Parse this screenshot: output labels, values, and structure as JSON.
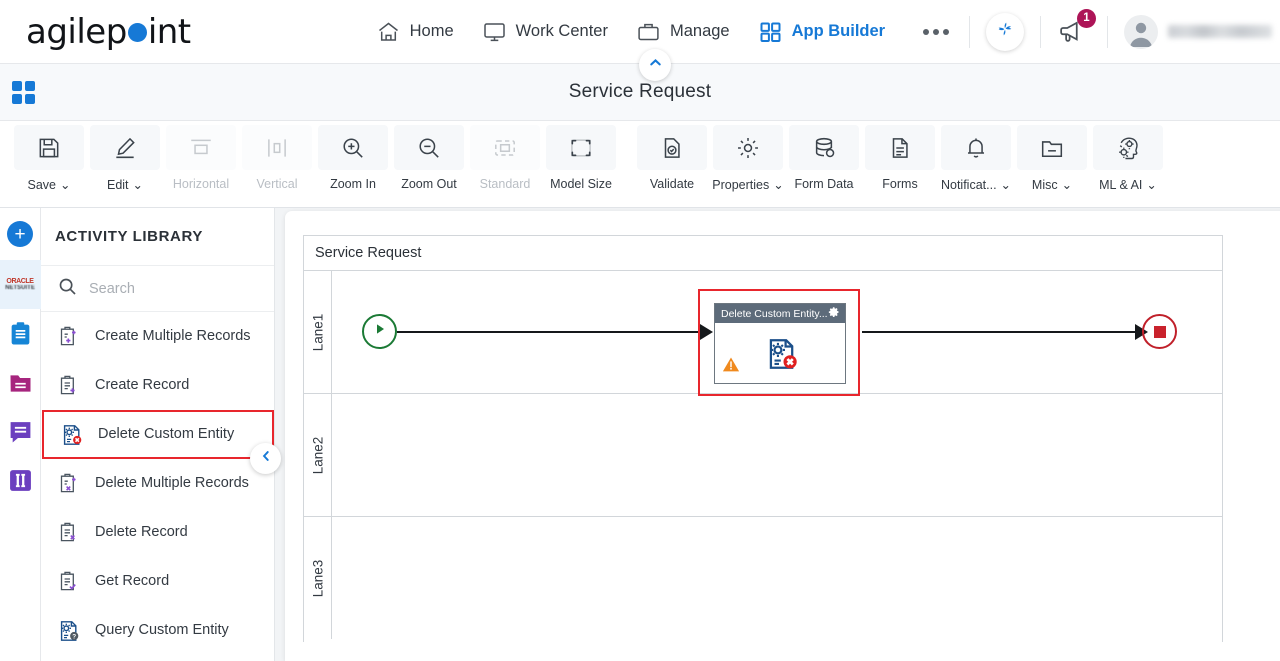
{
  "brand": {
    "name_a": "agilep",
    "name_b": "int",
    "accent": "#1679d6"
  },
  "topnav": {
    "items": [
      {
        "label": "Home",
        "icon": "home-icon",
        "active": false
      },
      {
        "label": "Work Center",
        "icon": "monitor-icon",
        "active": false
      },
      {
        "label": "Manage",
        "icon": "briefcase-icon",
        "active": false
      },
      {
        "label": "App Builder",
        "icon": "grid-icon",
        "active": true
      }
    ],
    "overflow_label": "...",
    "apps_icon": "pinwheel-icon",
    "announcements_icon": "megaphone-icon",
    "announcements_count": "1",
    "badge_color": "#ad1457",
    "avatar_icon": "user-avatar-icon",
    "username": ""
  },
  "module": {
    "grid_icon": "app-grid-icon",
    "title": "Service Request",
    "collapse_icon": "chevron-up-icon"
  },
  "toolbar": {
    "items": [
      {
        "label": "Save",
        "icon": "save-icon",
        "caret": true,
        "disabled": false
      },
      {
        "label": "Edit",
        "icon": "pencil-icon",
        "caret": true,
        "disabled": false
      },
      {
        "label": "Horizontal",
        "icon": "horizontal-icon",
        "caret": false,
        "disabled": true
      },
      {
        "label": "Vertical",
        "icon": "vertical-icon",
        "caret": false,
        "disabled": true
      },
      {
        "label": "Zoom In",
        "icon": "zoom-in-icon",
        "caret": false,
        "disabled": false
      },
      {
        "label": "Zoom Out",
        "icon": "zoom-out-icon",
        "caret": false,
        "disabled": false
      },
      {
        "label": "Standard",
        "icon": "standard-icon",
        "caret": false,
        "disabled": true
      },
      {
        "label": "Model Size",
        "icon": "model-size-icon",
        "caret": false,
        "disabled": false
      },
      {
        "label": "Validate",
        "icon": "validate-icon",
        "caret": false,
        "disabled": false
      },
      {
        "label": "Properties",
        "icon": "gear-icon",
        "caret": true,
        "disabled": false
      },
      {
        "label": "Form Data",
        "icon": "database-icon",
        "caret": false,
        "disabled": false
      },
      {
        "label": "Forms",
        "icon": "document-icon",
        "caret": false,
        "disabled": false
      },
      {
        "label": "Notificat...",
        "icon": "bell-icon",
        "caret": true,
        "disabled": false
      },
      {
        "label": "Misc",
        "icon": "folder-icon",
        "caret": true,
        "disabled": false
      },
      {
        "label": "ML & AI",
        "icon": "ml-ai-head-icon",
        "caret": true,
        "disabled": false
      }
    ]
  },
  "rail": {
    "items": [
      {
        "name": "add-button",
        "icon": "plus-icon",
        "selected": false
      },
      {
        "name": "oracle-netsuite",
        "icon": "oracle-netsuite-logo",
        "selected": true
      },
      {
        "name": "clipboard-group",
        "icon": "clipboard-icon",
        "selected": false
      },
      {
        "name": "folder-group",
        "icon": "folder-icon",
        "selected": false
      },
      {
        "name": "message-group",
        "icon": "speech-bubble-icon",
        "selected": false
      },
      {
        "name": "columns-group",
        "icon": "columns-icon",
        "selected": false
      }
    ],
    "oracle_line1": "ORACLE",
    "oracle_line2": "NETSUITE"
  },
  "library": {
    "header": "ACTIVITY LIBRARY",
    "search_placeholder": "Search",
    "search_value": "",
    "search_icon": "search-icon",
    "collapse_icon": "chevron-left-icon",
    "highlight_color": "#e8262d",
    "items": [
      {
        "label": "Create Multiple Records",
        "icon": "create-multiple-records-icon",
        "highlighted": false
      },
      {
        "label": "Create Record",
        "icon": "create-record-icon",
        "highlighted": false
      },
      {
        "label": "Delete Custom Entity",
        "icon": "delete-custom-entity-icon",
        "highlighted": true
      },
      {
        "label": "Delete Multiple Records",
        "icon": "delete-multiple-records-icon",
        "highlighted": false
      },
      {
        "label": "Delete Record",
        "icon": "delete-record-icon",
        "highlighted": false
      },
      {
        "label": "Get Record",
        "icon": "get-record-icon",
        "highlighted": false
      },
      {
        "label": "Query Custom Entity",
        "icon": "query-custom-entity-icon",
        "highlighted": false
      }
    ]
  },
  "canvas": {
    "pool_title": "Service Request",
    "lanes": [
      {
        "label": "Lane1"
      },
      {
        "label": "Lane2"
      },
      {
        "label": "Lane3"
      }
    ],
    "start_event": {
      "name": "start-event",
      "icon": "play-icon",
      "color": "#1b7a35"
    },
    "end_event": {
      "name": "end-event",
      "icon": "stop-square-icon",
      "color": "#c0202a"
    },
    "node": {
      "title": "Delete Custom Entity...",
      "gear_icon": "gear-icon",
      "warning_icon": "warning-triangle-icon",
      "body_icon": "delete-custom-entity-icon",
      "selected": true,
      "selection_color": "#e8262d",
      "header_color": "#5d6b7a"
    }
  }
}
